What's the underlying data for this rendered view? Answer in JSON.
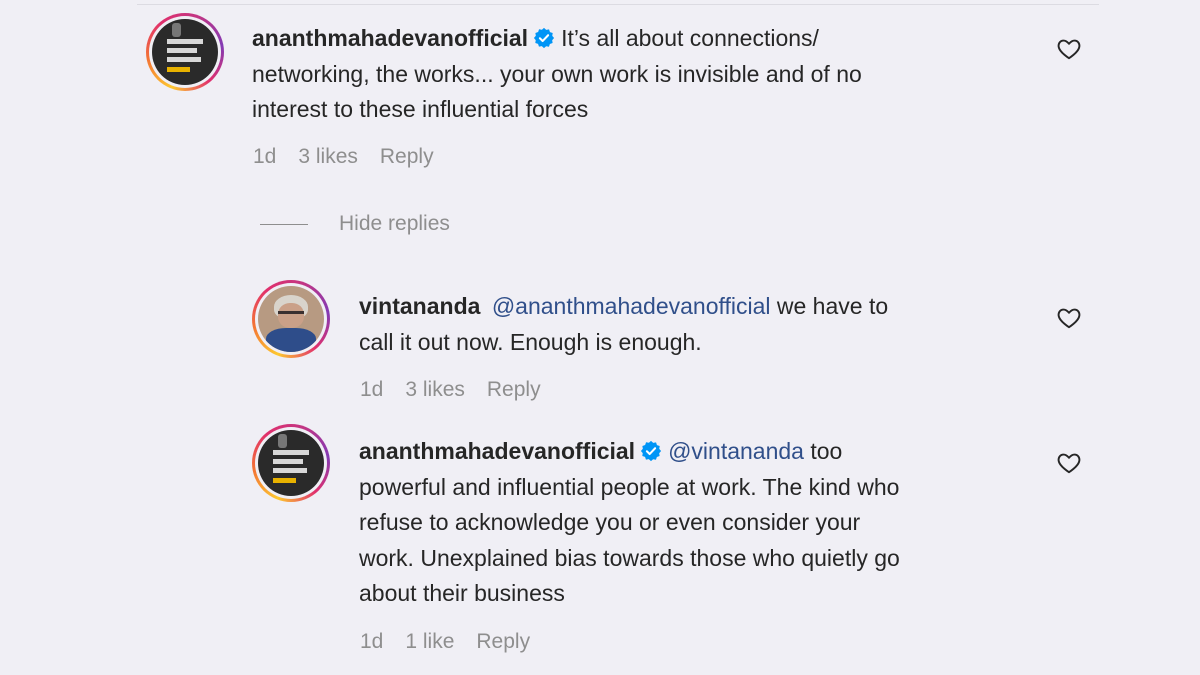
{
  "comments": [
    {
      "username": "ananthmahadevanofficial",
      "verified": true,
      "mention": "",
      "lines": [
        "It’s all about connections/",
        "networking, the works... your own work is invisible and of no",
        "interest to these influential forces"
      ],
      "time": "1d",
      "likes": "3 likes",
      "reply": "Reply"
    },
    {
      "username": "vintananda",
      "verified": false,
      "mention": "@ananthmahadevanofficial",
      "lines": [
        "we have to",
        "call it out now. Enough is enough."
      ],
      "time": "1d",
      "likes": "3 likes",
      "reply": "Reply"
    },
    {
      "username": "ananthmahadevanofficial",
      "verified": true,
      "mention": "@vintananda",
      "lines": [
        "too",
        "powerful and influential people at work. The kind who",
        "refuse to acknowledge you or even consider your",
        "work. Unexplained bias towards those who quietly go",
        "about their business"
      ],
      "time": "1d",
      "likes": "1 like",
      "reply": "Reply"
    }
  ],
  "hide_replies_label": "Hide replies",
  "colors": {
    "verified": "#0095f6",
    "mention": "#304f8a",
    "meta": "#8e8e8e",
    "background": "#f0eff5"
  }
}
